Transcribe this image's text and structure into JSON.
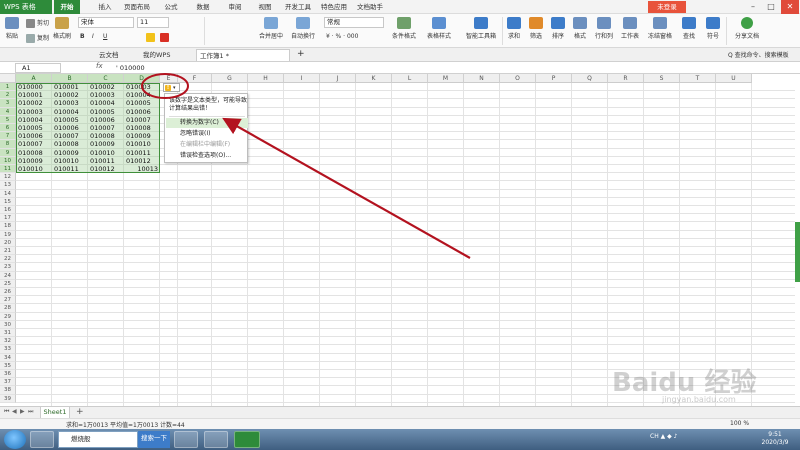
{
  "titlebar": {
    "app_name": "WPS 表格",
    "menu_tabs": [
      "开始",
      "插入",
      "页面布局",
      "公式",
      "数据",
      "审阅",
      "视图",
      "开发工具",
      "特色应用",
      "文档助手"
    ],
    "login_label": "未登录",
    "min": "–",
    "max": "□",
    "close": "✕"
  },
  "ribbon": {
    "paste": "粘贴",
    "cut": "剪切",
    "copy": "复制",
    "format_painter": "格式刷",
    "font_name": "宋体",
    "font_size": "11",
    "merge_center": "合并居中",
    "wrap_text": "自动换行",
    "number_format": "常规",
    "cond_format": "条件格式",
    "table_style": "表格样式",
    "smart_toolbox": "智能工具箱",
    "sum": "求和",
    "filter": "筛选",
    "sort": "排序",
    "format": "格式",
    "row_col": "行和列",
    "worksheet": "工作表",
    "freeze": "冻结窗格",
    "find": "查找",
    "symbol": "符号",
    "share": "分享文档"
  },
  "docbar": {
    "tabs": [
      "云文档",
      "我的WPS",
      "工作簿1 *"
    ],
    "search_hint": "Q 查找命令、搜索模板"
  },
  "formulabar": {
    "cell_ref": "A1",
    "fx": "fx",
    "value": "' 010000"
  },
  "grid": {
    "columns": [
      "A",
      "B",
      "C",
      "D",
      "E",
      "F",
      "G",
      "H",
      "I",
      "J",
      "K",
      "L",
      "M",
      "N",
      "O",
      "P",
      "Q",
      "R",
      "S",
      "T",
      "U"
    ],
    "rows": [
      "1",
      "2",
      "3",
      "4",
      "5",
      "6",
      "7",
      "8",
      "9",
      "10",
      "11",
      "12",
      "13",
      "14",
      "15",
      "16",
      "17",
      "18",
      "19",
      "20",
      "21",
      "22",
      "23",
      "24",
      "25",
      "26",
      "27",
      "28",
      "29",
      "30",
      "31",
      "32",
      "33",
      "34",
      "35",
      "36",
      "37",
      "38",
      "39"
    ],
    "data": [
      [
        "010000",
        "010001",
        "010002",
        "010003"
      ],
      [
        "010001",
        "010002",
        "010003",
        "010004"
      ],
      [
        "010002",
        "010003",
        "010004",
        "010005"
      ],
      [
        "010003",
        "010004",
        "010005",
        "010006"
      ],
      [
        "010004",
        "010005",
        "010006",
        "010007"
      ],
      [
        "010005",
        "010006",
        "010007",
        "010008"
      ],
      [
        "010006",
        "010007",
        "010008",
        "010009"
      ],
      [
        "010007",
        "010008",
        "010009",
        "010010"
      ],
      [
        "010008",
        "010009",
        "010010",
        "010011"
      ],
      [
        "010009",
        "010010",
        "010011",
        "010012"
      ],
      [
        "010010",
        "010011",
        "010012",
        "10013"
      ]
    ]
  },
  "error_menu": {
    "description": "该数字是文本类型，可能导致计算结果出错！",
    "items": [
      "转换为数字(C)",
      "忽略错误(I)",
      "在编辑栏中编辑(F)",
      "错误检查选项(O)..."
    ]
  },
  "sheetbar": {
    "sheet_name": "Sheet1",
    "add": "+"
  },
  "statusbar": {
    "summary": "求和=1万0013   平均值=1万0013   计数=44",
    "zoom": "100 %"
  },
  "taskbar": {
    "browser_text": "燃烧般",
    "browser_btn": "搜索一下",
    "tray": "CH ▲ ◆ ♪",
    "time": "9:51",
    "date": "2020/3/9"
  },
  "watermark": {
    "brand": "Baidu 经验",
    "url": "jingyan.baidu.com"
  },
  "colors": {
    "accent": "#2e8b3a",
    "annotation": "#b3121f",
    "selection": "#3f8f3a"
  }
}
